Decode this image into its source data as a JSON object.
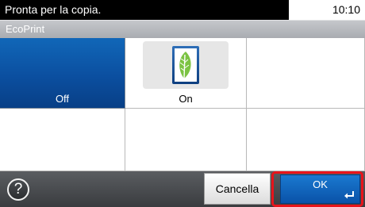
{
  "status": {
    "message": "Pronta per la copia.",
    "time": "10:10"
  },
  "screen": {
    "title": "EcoPrint"
  },
  "options": [
    {
      "label": "Off",
      "selected": true
    },
    {
      "label": "On",
      "selected": false,
      "icon": "leaf-icon"
    }
  ],
  "footer": {
    "help_icon": "question-mark-icon",
    "help_symbol": "?",
    "cancel_label": "Cancella",
    "ok_label": "OK",
    "ok_icon": "enter-icon"
  },
  "colors": {
    "selected_blue": "#0b4fa0",
    "highlight_red": "#e8141b",
    "leaf_green": "#6fbf3a"
  }
}
